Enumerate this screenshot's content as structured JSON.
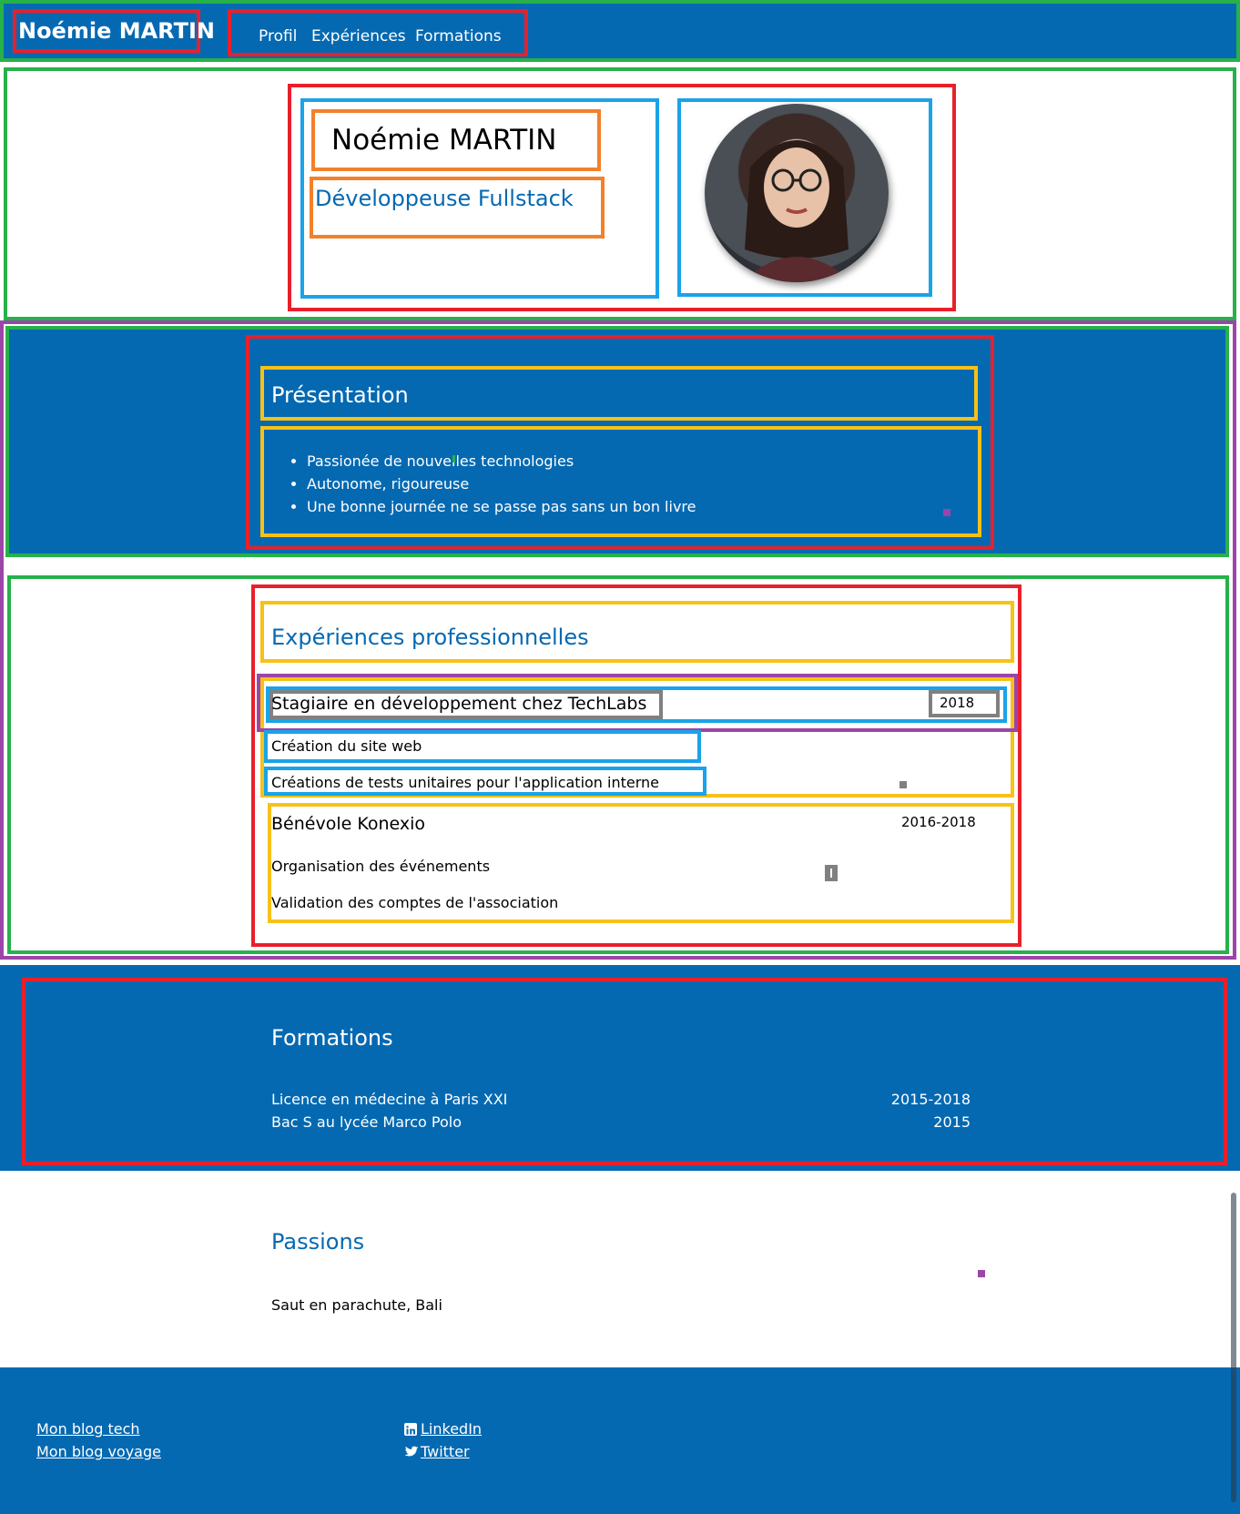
{
  "header": {
    "brand": "Noémie MARTIN",
    "nav": [
      "Profil",
      "Expériences",
      "Formations"
    ]
  },
  "hero": {
    "name": "Noémie MARTIN",
    "role": "Développeuse Fullstack"
  },
  "presentation": {
    "title": "Présentation",
    "items": [
      "Passionée de nouvelles technologies",
      "Autonome, rigoureuse",
      "Une bonne journée ne se passe pas sans un bon livre"
    ]
  },
  "experiences": {
    "title": "Expériences professionnelles",
    "jobs": [
      {
        "title": "Stagiaire en développement chez TechLabs",
        "date": "2018",
        "tasks": [
          "Création du site web",
          "Créations de tests unitaires pour l'application interne"
        ]
      },
      {
        "title": "Bénévole Konexio",
        "date": "2016-2018",
        "tasks": [
          "Organisation des événements",
          "Validation des comptes de l'association"
        ]
      }
    ]
  },
  "formations": {
    "title": "Formations",
    "items": [
      {
        "label": "Licence en médecine à Paris XXI",
        "date": "2015-2018"
      },
      {
        "label": "Bac S au lycée Marco Polo",
        "date": "2015"
      }
    ]
  },
  "passions": {
    "title": "Passions",
    "text": "Saut en parachute, Bali"
  },
  "footer": {
    "blog_tech": "Mon blog tech",
    "blog_voyage": "Mon blog voyage",
    "linkedin": "LinkedIn",
    "twitter": "Twitter"
  },
  "colors": {
    "primary": "#0569b2",
    "debug_red": "#e8202a",
    "debug_green": "#27b14a",
    "debug_cyan": "#1aa3e8",
    "debug_orange": "#f3802b",
    "debug_yellow": "#f7c118",
    "debug_purple": "#9b45a9"
  }
}
